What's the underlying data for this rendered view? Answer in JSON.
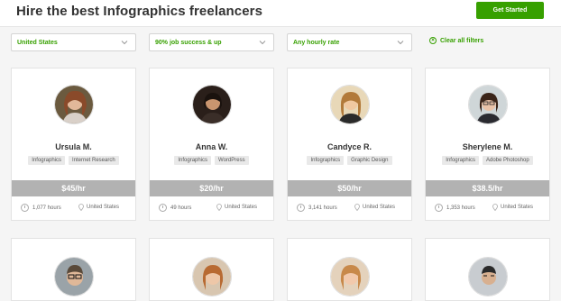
{
  "header": {
    "title": "Hire the best Infographics freelancers",
    "cta_label": "Get Started"
  },
  "filters": {
    "country": "United States",
    "job_success": "90% job success & up",
    "rate": "Any hourly rate",
    "clear_label": "Clear all filters"
  },
  "colors": {
    "brand_green": "#37a000",
    "price_bar": "#b2b2b2"
  },
  "freelancers": [
    {
      "name": "Ursula M.",
      "tags": [
        "Infographics",
        "Internet Research"
      ],
      "rate": "$45/hr",
      "hours": "1,077 hours",
      "location": "United States"
    },
    {
      "name": "Anna W.",
      "tags": [
        "Infographics",
        "WordPress"
      ],
      "rate": "$20/hr",
      "hours": "49 hours",
      "location": "United States"
    },
    {
      "name": "Candyce R.",
      "tags": [
        "Infographics",
        "Graphic Design"
      ],
      "rate": "$50/hr",
      "hours": "3,141 hours",
      "location": "United States"
    },
    {
      "name": "Sherylene M.",
      "tags": [
        "Infographics",
        "Adobe Photoshop"
      ],
      "rate": "$38.5/hr",
      "hours": "1,353 hours",
      "location": "United States"
    }
  ],
  "icons": {
    "clock": "clock-icon",
    "location": "map-pin-icon",
    "chevron": "chevron-down-icon",
    "clear": "close-circle-icon"
  }
}
